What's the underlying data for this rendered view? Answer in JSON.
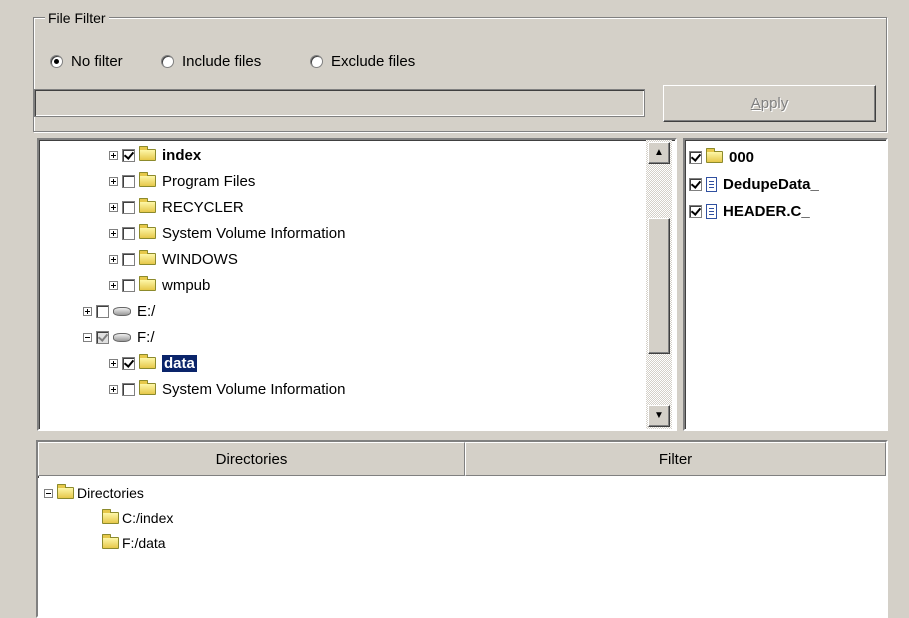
{
  "file_filter": {
    "title": "File Filter",
    "options": [
      {
        "label": "No filter",
        "checked": true
      },
      {
        "label": "Include files",
        "checked": false
      },
      {
        "label": "Exclude files",
        "checked": false
      }
    ],
    "pattern_value": "",
    "apply_mnemonic": "A",
    "apply_rest": "pply",
    "apply_enabled": false
  },
  "tree": {
    "rows": [
      {
        "label": "index",
        "checked": true,
        "bold": true
      },
      {
        "label": "Program Files",
        "checked": false
      },
      {
        "label": "RECYCLER",
        "checked": false
      },
      {
        "label": "System Volume Information",
        "checked": false
      },
      {
        "label": "WINDOWS",
        "checked": false
      },
      {
        "label": "wmpub",
        "checked": false
      },
      {
        "label": "E:/",
        "checked": false,
        "icon": "drive-icon"
      },
      {
        "label": "F:/",
        "checked": "partial",
        "icon": "drive-icon",
        "expanded": true
      },
      {
        "label": "data",
        "checked": true,
        "selected": true
      },
      {
        "label": "System Volume Information",
        "checked": false
      }
    ]
  },
  "files": {
    "items": [
      {
        "label": "000",
        "checked": true,
        "icon": "folder-icon"
      },
      {
        "label": "DedupeData_",
        "checked": true,
        "icon": "file-icon"
      },
      {
        "label": "HEADER.C_",
        "checked": true,
        "icon": "file-icon"
      }
    ]
  },
  "list": {
    "columns": [
      "Directories",
      "Filter"
    ],
    "root": "Directories",
    "items": [
      "C:/index",
      "F:/data"
    ]
  },
  "colors": {
    "face": "#d4d0c8",
    "selection": "#0a246a"
  }
}
